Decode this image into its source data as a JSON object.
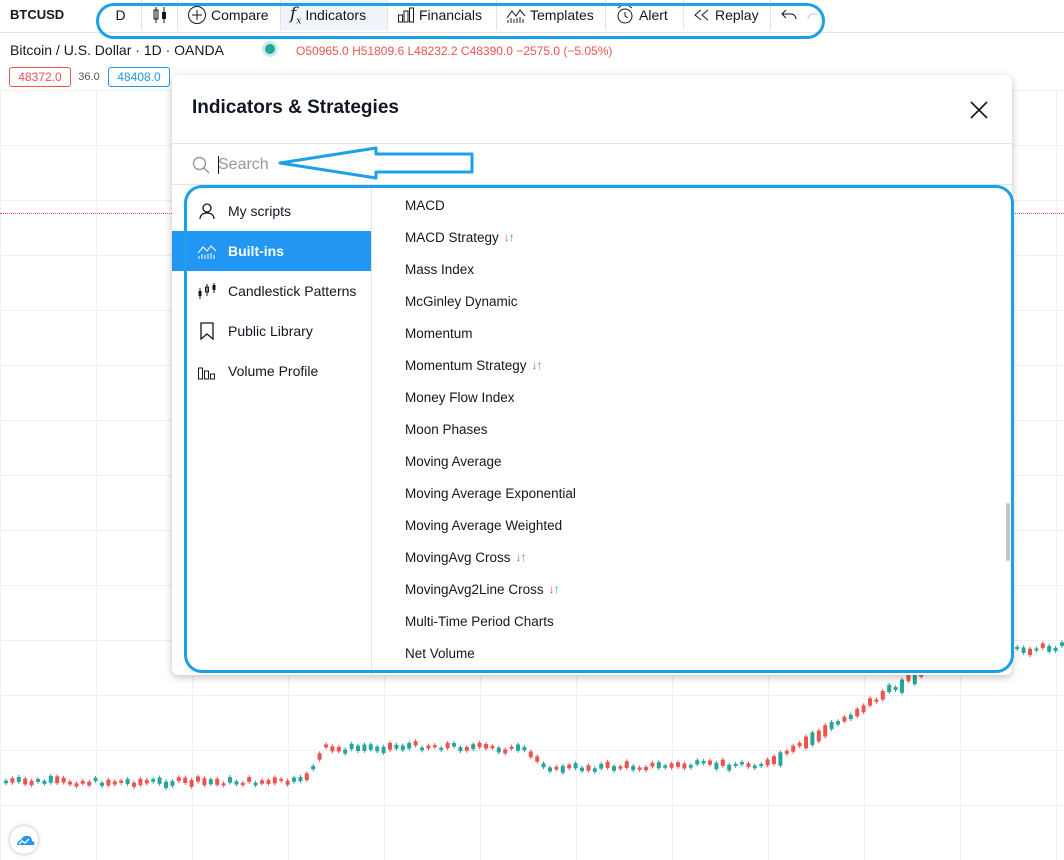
{
  "toolbar": {
    "symbol": "BTCUSD",
    "interval": "D",
    "compare": "Compare",
    "indicators": "Indicators",
    "financials": "Financials",
    "templates": "Templates",
    "alert": "Alert",
    "replay": "Replay"
  },
  "legend": {
    "title": "Bitcoin / U.S. Dollar · 1D · OANDA",
    "open_key": "O",
    "open": "50965.0",
    "high_key": "H",
    "high": "51809.6",
    "low_key": "L",
    "low": "48232.2",
    "close_key": "C",
    "close": "48390.0",
    "change": "−2575.0 (−5.05%)",
    "bid": "48372.0",
    "spread": "36.0",
    "ask": "48408.0"
  },
  "dialog": {
    "title": "Indicators & Strategies",
    "search_placeholder": "Search",
    "sidebar": [
      {
        "label": "My scripts",
        "icon": "user-icon",
        "active": false
      },
      {
        "label": "Built-ins",
        "icon": "chart-icon",
        "active": true
      },
      {
        "label": "Candlestick Patterns",
        "icon": "candlestick-icon",
        "active": false
      },
      {
        "label": "Public Library",
        "icon": "bookmark-icon",
        "active": false
      },
      {
        "label": "Volume Profile",
        "icon": "volume-profile-icon",
        "active": false
      }
    ],
    "items": [
      {
        "label": "MACD",
        "strategy": false
      },
      {
        "label": "MACD Strategy",
        "strategy": true
      },
      {
        "label": "Mass Index",
        "strategy": false
      },
      {
        "label": "McGinley Dynamic",
        "strategy": false
      },
      {
        "label": "Momentum",
        "strategy": false
      },
      {
        "label": "Momentum Strategy",
        "strategy": true
      },
      {
        "label": "Money Flow Index",
        "strategy": false
      },
      {
        "label": "Moon Phases",
        "strategy": false
      },
      {
        "label": "Moving Average",
        "strategy": false
      },
      {
        "label": "Moving Average Exponential",
        "strategy": false
      },
      {
        "label": "Moving Average Weighted",
        "strategy": false
      },
      {
        "label": "MovingAvg Cross",
        "strategy": true
      },
      {
        "label": "MovingAvg2Line Cross",
        "strategy": true
      },
      {
        "label": "Multi-Time Period Charts",
        "strategy": false
      },
      {
        "label": "Net Volume",
        "strategy": false
      }
    ],
    "strategy_down": "↓",
    "strategy_up": "↑"
  },
  "colors": {
    "accent": "#2196f3",
    "highlight": "#1aa1e6",
    "up": "#26a69a",
    "down": "#ef5350"
  }
}
